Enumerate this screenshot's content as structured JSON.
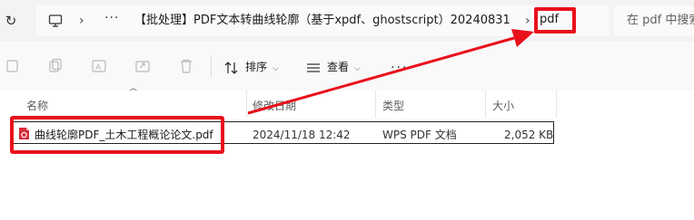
{
  "address": {
    "ellipsis": "···",
    "folder": "【批处理】PDF文本转曲线轮廓（基于xpdf、ghostscript）20240831",
    "current": "pdf"
  },
  "search": {
    "placeholder": "在 pdf 中搜索"
  },
  "toolbar": {
    "sort_label": "排序",
    "view_label": "查看",
    "more_label": "···"
  },
  "columns": {
    "name": "名称",
    "modified": "修改日期",
    "type": "类型",
    "size": "大小"
  },
  "files": [
    {
      "name": "曲线轮廓PDF_土木工程概论论文.pdf",
      "modified": "2024/11/18 12:42",
      "type": "WPS PDF 文档",
      "size": "2,052 KB"
    }
  ],
  "colors": {
    "highlight": "#e8101b",
    "pdf_icon": "#d62c3a"
  }
}
